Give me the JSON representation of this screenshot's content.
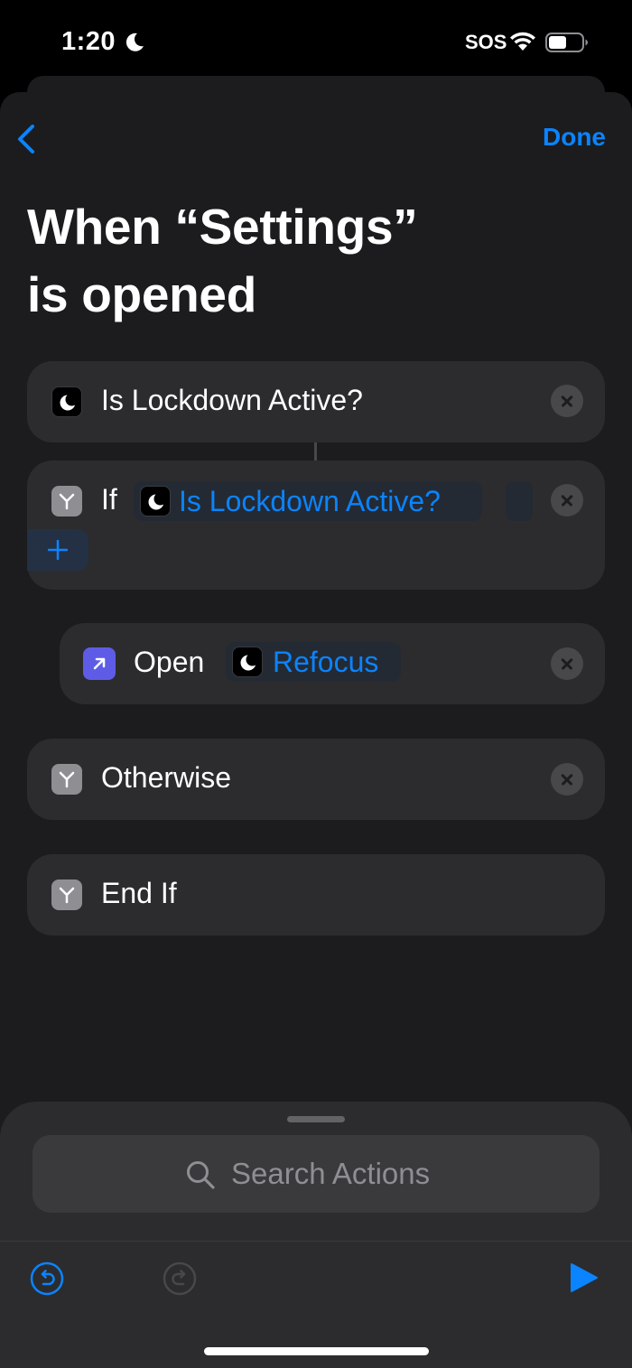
{
  "status_bar": {
    "time": "1:20",
    "carrier": "SOS",
    "focus_icon": "moon-icon",
    "wifi_icon": "wifi-icon",
    "battery_icon": "battery-icon",
    "battery_level": 0.55
  },
  "nav": {
    "back_icon": "chevron-left-icon",
    "done_label": "Done"
  },
  "title": {
    "line1": "When “Settings”",
    "line2": "is opened"
  },
  "actions": [
    {
      "id": "is-lockdown-active",
      "icon": "moon-app-icon",
      "label": "Is Lockdown Active?",
      "removable": true
    },
    {
      "id": "if",
      "icon": "scripting-if-icon",
      "label": "If",
      "token_label": "Is Lockdown Active?",
      "token_icon": "moon-app-icon",
      "add_icon": "plus-icon",
      "removable": true
    },
    {
      "id": "open-app",
      "icon": "open-app-arrow-icon",
      "label": "Open",
      "token_label": "Refocus",
      "token_icon": "moon-app-icon",
      "removable": true
    },
    {
      "id": "otherwise",
      "icon": "scripting-if-icon",
      "label": "Otherwise",
      "removable": true
    },
    {
      "id": "end-if",
      "icon": "scripting-if-icon",
      "label": "End If",
      "removable": false
    }
  ],
  "bottom": {
    "search_placeholder": "Search Actions",
    "search_icon": "magnifying-glass-icon",
    "undo_icon": "undo-icon",
    "redo_icon": "redo-icon",
    "run_icon": "play-icon"
  },
  "colors": {
    "accent": "#0a84ff",
    "sheet_background": "#1c1c1e",
    "card_background": "#2c2c2e",
    "open_app_icon": "#5e5ce6",
    "scripting_icon": "#8e8e93"
  }
}
